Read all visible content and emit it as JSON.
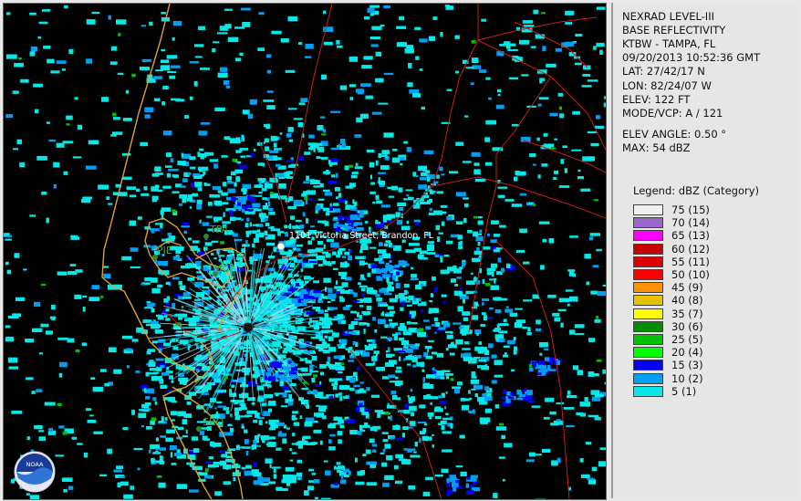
{
  "info": {
    "lines": [
      "NEXRAD LEVEL-III",
      "BASE REFLECTIVITY",
      "KTBW - TAMPA, FL",
      "09/20/2013 10:52:36 GMT",
      "LAT: 27/42/17 N",
      "LON: 82/24/07 W",
      "ELEV: 122 FT",
      "MODE/VCP: A / 121"
    ],
    "elev_angle": "ELEV ANGLE: 0.50 °",
    "max": "MAX: 54 dBZ"
  },
  "legend": {
    "title": "Legend: dBZ (Category)",
    "entries": [
      {
        "label": "75  (15)",
        "color": "#f0f0f0"
      },
      {
        "label": "70  (14)",
        "color": "#9966cc"
      },
      {
        "label": "65  (13)",
        "color": "#ff00ff"
      },
      {
        "label": "60  (12)",
        "color": "#c80000"
      },
      {
        "label": "55  (11)",
        "color": "#dc0000"
      },
      {
        "label": "50  (10)",
        "color": "#ff0000"
      },
      {
        "label": "45  (9)",
        "color": "#ff9000"
      },
      {
        "label": "40  (8)",
        "color": "#e7c000"
      },
      {
        "label": "35  (7)",
        "color": "#ffff00"
      },
      {
        "label": "30  (6)",
        "color": "#008e00"
      },
      {
        "label": "25  (5)",
        "color": "#00c000"
      },
      {
        "label": "20  (4)",
        "color": "#00ff00"
      },
      {
        "label": "15  (3)",
        "color": "#0000f6"
      },
      {
        "label": "10  (2)",
        "color": "#019ff4"
      },
      {
        "label": "5  (1)",
        "color": "#04e9e7"
      }
    ]
  },
  "map": {
    "stations": [
      "TPA",
      "PIE",
      "MCF",
      "SRQ"
    ],
    "address": "1101 Victoria Street, Brandon, FL",
    "logo_text": "NOAA",
    "colors": {
      "coast": "#e0a030",
      "roads": "#c81e1e",
      "echo_light": "#04e9e7",
      "echo_mid": "#019ff4",
      "echo_heavy": "#0000f6",
      "echo_green": "#00c000"
    }
  }
}
